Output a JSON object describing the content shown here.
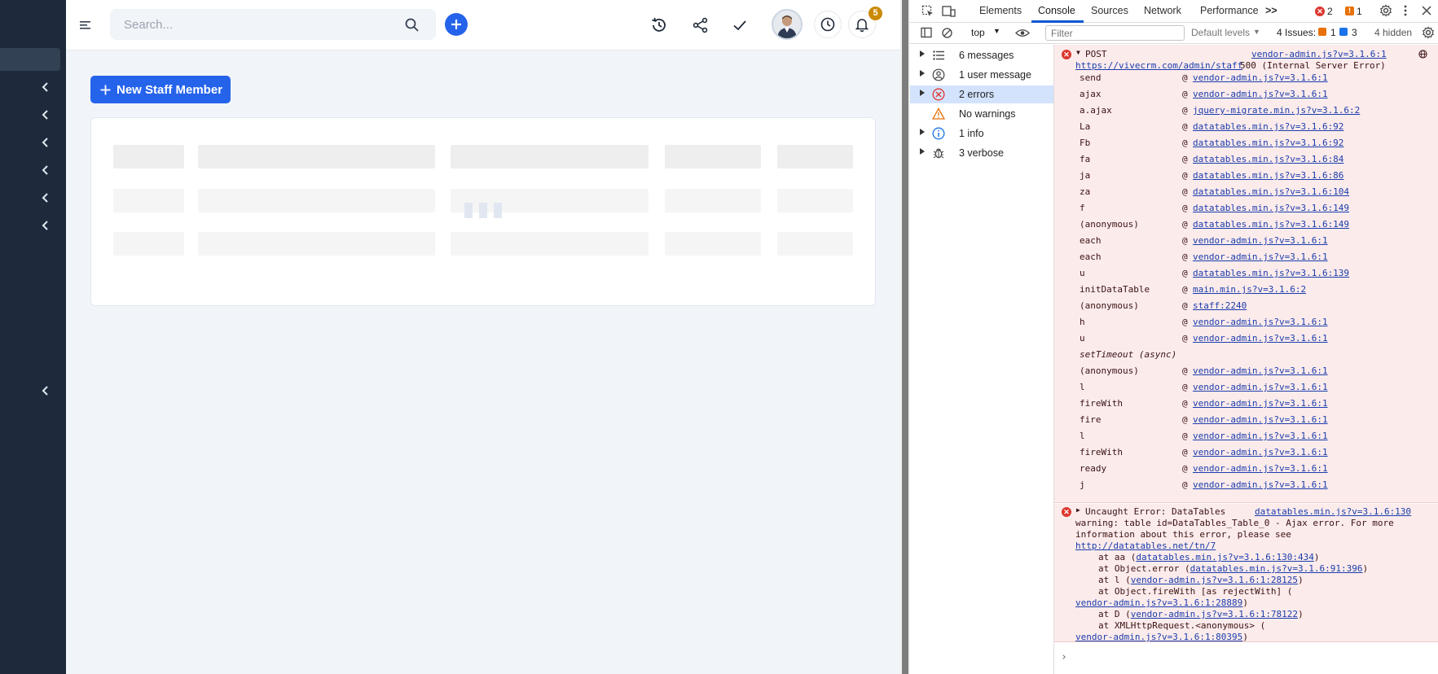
{
  "header": {
    "search_placeholder": "Search...",
    "notification_count": "5"
  },
  "main": {
    "new_button_label": "New Staff Member"
  },
  "devtools": {
    "tabs": [
      "Elements",
      "Console",
      "Sources",
      "Network",
      "Performance"
    ],
    "more_tabs": ">>",
    "error_count": "2",
    "warning_count": "1",
    "context": "top",
    "filter_placeholder": "Filter",
    "levels": "Default levels",
    "issues_label": "4 Issues:",
    "issues_warn": "1",
    "issues_info": "3",
    "hidden": "4 hidden",
    "groups": [
      {
        "label": "6 messages",
        "icon": "list-icon"
      },
      {
        "label": "1 user message",
        "icon": "user-icon"
      },
      {
        "label": "2 errors",
        "icon": "error-icon"
      },
      {
        "label": "No warnings",
        "icon": "warning-icon"
      },
      {
        "label": "1 info",
        "icon": "info-icon"
      },
      {
        "label": "3 verbose",
        "icon": "bug-icon"
      }
    ],
    "error1": {
      "method": "POST",
      "source": "vendor-admin.js?v=3.1.6:1",
      "url": "https://vivecrm.com/admin/staff",
      "status": "500 (Internal Server Error)",
      "stack": [
        {
          "fn": "send",
          "src": "vendor-admin.js?v=3.1.6:1"
        },
        {
          "fn": "ajax",
          "src": "vendor-admin.js?v=3.1.6:1"
        },
        {
          "fn": "a.ajax",
          "src": "jquery-migrate.min.js?v=3.1.6:2"
        },
        {
          "fn": "La",
          "src": "datatables.min.js?v=3.1.6:92"
        },
        {
          "fn": "Fb",
          "src": "datatables.min.js?v=3.1.6:92"
        },
        {
          "fn": "fa",
          "src": "datatables.min.js?v=3.1.6:84"
        },
        {
          "fn": "ja",
          "src": "datatables.min.js?v=3.1.6:86"
        },
        {
          "fn": "za",
          "src": "datatables.min.js?v=3.1.6:104"
        },
        {
          "fn": "f",
          "src": "datatables.min.js?v=3.1.6:149"
        },
        {
          "fn": "(anonymous)",
          "src": "datatables.min.js?v=3.1.6:149"
        },
        {
          "fn": "each",
          "src": "vendor-admin.js?v=3.1.6:1"
        },
        {
          "fn": "each",
          "src": "vendor-admin.js?v=3.1.6:1"
        },
        {
          "fn": "u",
          "src": "datatables.min.js?v=3.1.6:139"
        },
        {
          "fn": "initDataTable",
          "src": "main.min.js?v=3.1.6:2"
        },
        {
          "fn": "(anonymous)",
          "src": "staff:2240"
        },
        {
          "fn": "h",
          "src": "vendor-admin.js?v=3.1.6:1"
        },
        {
          "fn": "u",
          "src": "vendor-admin.js?v=3.1.6:1"
        },
        {
          "fn": "setTimeout (async)",
          "src": ""
        },
        {
          "fn": "(anonymous)",
          "src": "vendor-admin.js?v=3.1.6:1"
        },
        {
          "fn": "l",
          "src": "vendor-admin.js?v=3.1.6:1"
        },
        {
          "fn": "fireWith",
          "src": "vendor-admin.js?v=3.1.6:1"
        },
        {
          "fn": "fire",
          "src": "vendor-admin.js?v=3.1.6:1"
        },
        {
          "fn": "l",
          "src": "vendor-admin.js?v=3.1.6:1"
        },
        {
          "fn": "fireWith",
          "src": "vendor-admin.js?v=3.1.6:1"
        },
        {
          "fn": "ready",
          "src": "vendor-admin.js?v=3.1.6:1"
        },
        {
          "fn": "j",
          "src": "vendor-admin.js?v=3.1.6:1"
        }
      ]
    },
    "error2": {
      "title": "Uncaught Error: DataTables",
      "source": "datatables.min.js?v=3.1.6:130",
      "line2": "warning: table id=DataTables_Table_0 - Ajax error. For more",
      "line3": "information about this error, please see",
      "link": "http://datatables.net/tn/7",
      "s1_pre": "at aa (",
      "s1_link": "datatables.min.js?v=3.1.6:130:434",
      "s1_post": ")",
      "s2_pre": "at Object.error (",
      "s2_link": "datatables.min.js?v=3.1.6:91:396",
      "s2_post": ")",
      "s3_pre": "at l (",
      "s3_link": "vendor-admin.js?v=3.1.6:1:28125",
      "s3_post": ")",
      "s4_pre": "at Object.fireWith [as rejectWith] (",
      "s4_link": "vendor-admin.js?v=3.1.6:1:28889",
      "s4_post": ")",
      "s5_pre": "at D (",
      "s5_link": "vendor-admin.js?v=3.1.6:1:78122",
      "s5_post": ")",
      "s6_pre": "at XMLHttpRequest.<anonymous> (",
      "s6_link": "vendor-admin.js?v=3.1.6:1:80395",
      "s6_post": ")"
    },
    "prompt": "›"
  }
}
